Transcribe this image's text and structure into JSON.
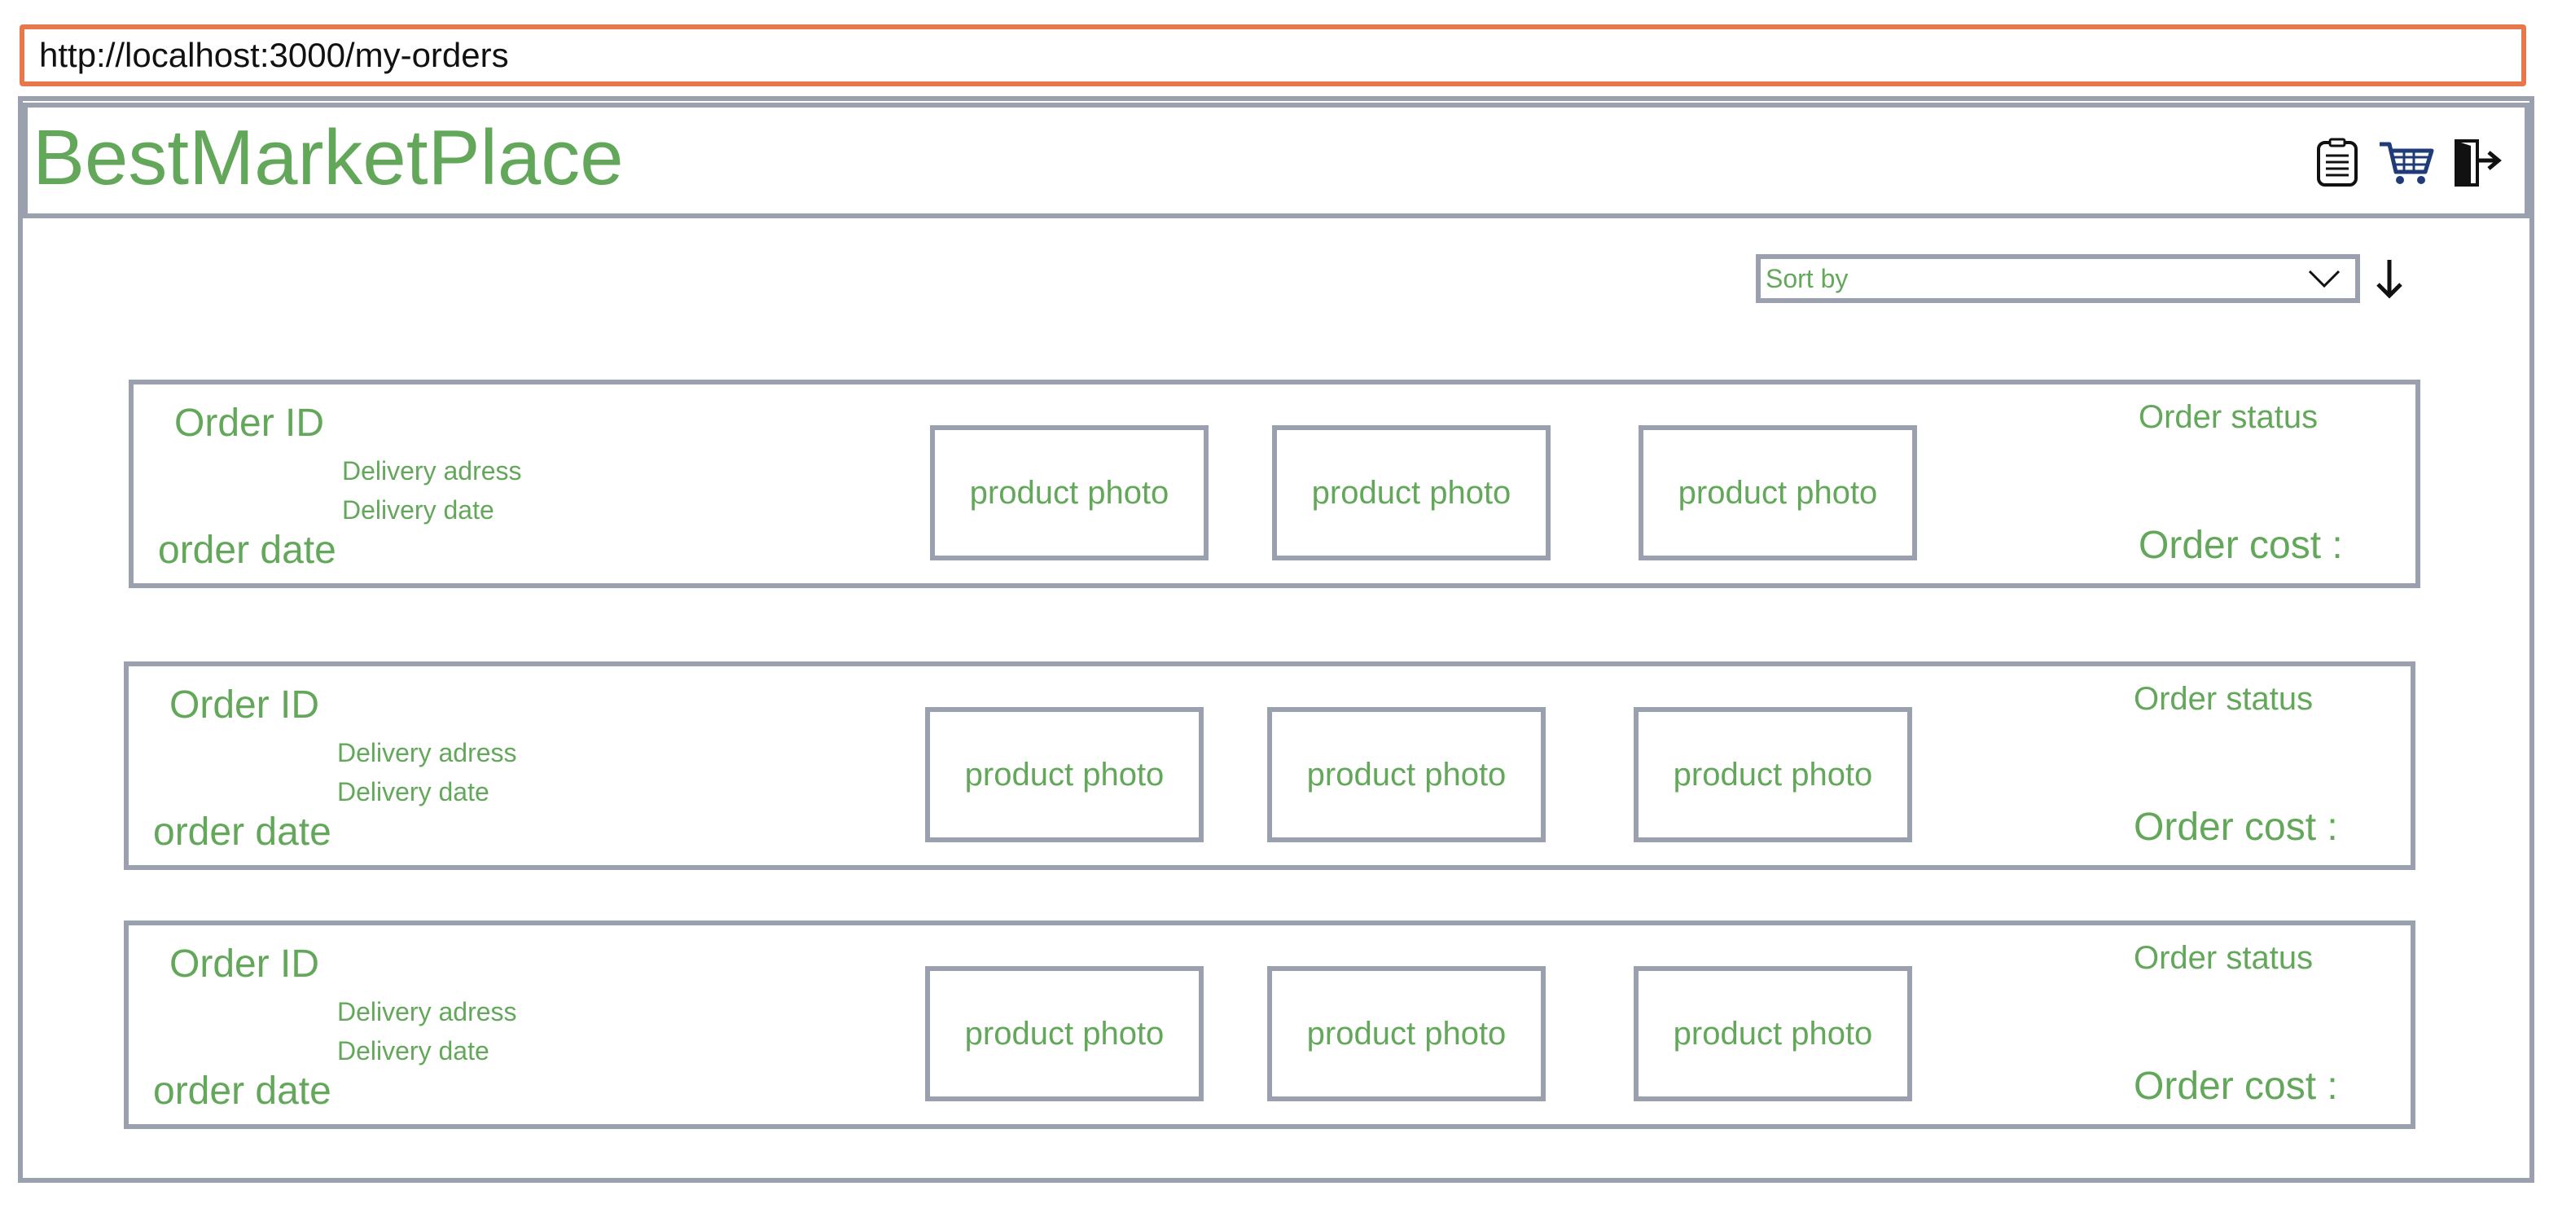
{
  "browser": {
    "url": "http://localhost:3000/my-orders"
  },
  "header": {
    "brand": "BestMarketPlace",
    "icons": [
      "orders-list-icon",
      "cart-icon",
      "logout-icon"
    ]
  },
  "sort": {
    "label": "Sort by"
  },
  "orders": [
    {
      "id_label": "Order ID",
      "address_label": "Delivery adress",
      "delivery_date_label": "Delivery date",
      "order_date_label": "order date",
      "status_label": "Order status",
      "cost_label": "Order cost :",
      "photos": [
        "product photo",
        "product photo",
        "product photo"
      ]
    },
    {
      "id_label": "Order ID",
      "address_label": "Delivery adress",
      "delivery_date_label": "Delivery date",
      "order_date_label": "order date",
      "status_label": "Order status",
      "cost_label": "Order cost :",
      "photos": [
        "product photo",
        "product photo",
        "product photo"
      ]
    },
    {
      "id_label": "Order ID",
      "address_label": "Delivery adress",
      "delivery_date_label": "Delivery date",
      "order_date_label": "order date",
      "status_label": "Order status",
      "cost_label": "Order cost :",
      "photos": [
        "product photo",
        "product photo",
        "product photo"
      ]
    }
  ],
  "colors": {
    "accent": "#63a85a",
    "border": "#9aa0ae",
    "url_border": "#e8784c",
    "cart": "#1f3b78"
  }
}
